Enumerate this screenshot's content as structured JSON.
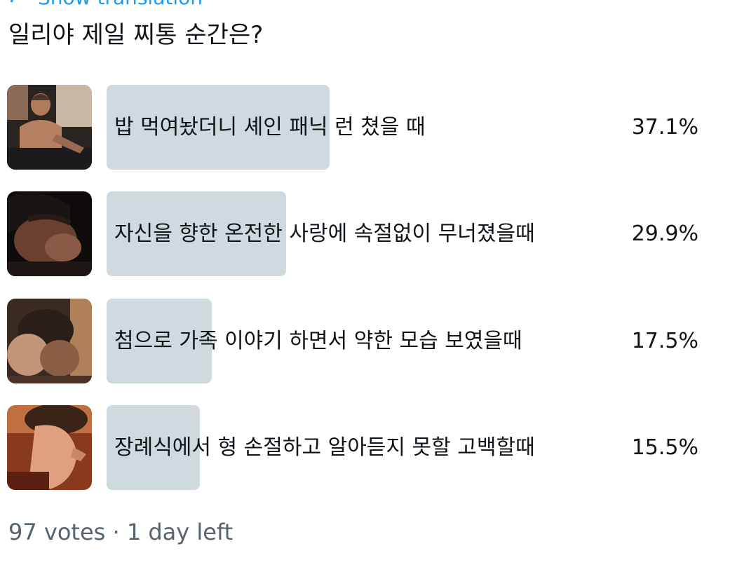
{
  "header": {
    "translate_label": "Show translation"
  },
  "poll": {
    "question": "일리야 제일 찌통 순간은?",
    "options": [
      {
        "label": "밥 먹여놨더니 셰인 패닉 런 쳤을 때",
        "percent_text": "37.1%",
        "percent": 37.1
      },
      {
        "label": "자신을 향한 온전한 사랑에 속절없이 무너졌을때",
        "percent_text": "29.9%",
        "percent": 29.9
      },
      {
        "label": "첨으로 가족 이야기 하면서 약한 모습 보였을때",
        "percent_text": "17.5%",
        "percent": 17.5
      },
      {
        "label": "장례식에서 형 손절하고 알아듣지 못할 고백할때",
        "percent_text": "15.5%",
        "percent": 15.5
      }
    ],
    "votes": "97 votes",
    "separator": "·",
    "time_left": "1 day left"
  },
  "colors": {
    "bar": "#cfd9de",
    "link": "#1d9bf0",
    "muted": "#536471"
  }
}
